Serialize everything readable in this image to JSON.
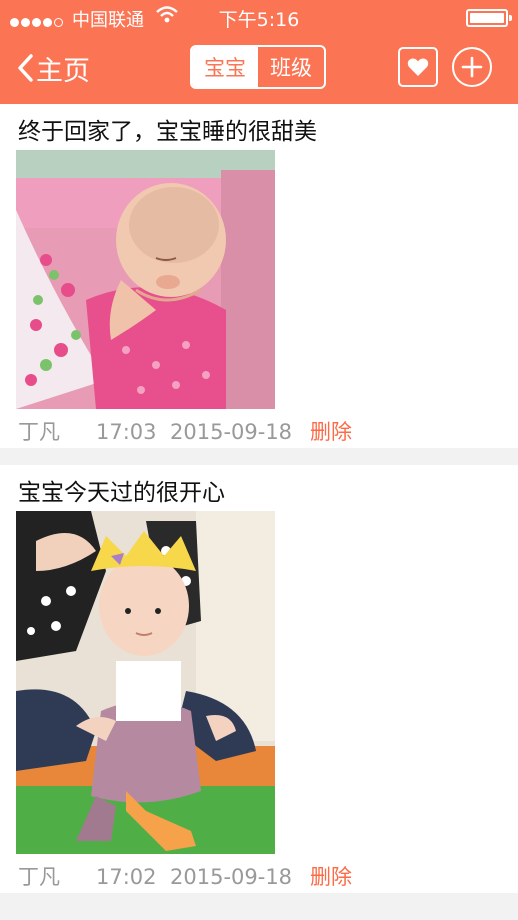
{
  "statusbar": {
    "carrier": "中国联通",
    "time": "下午5:16"
  },
  "nav": {
    "back_label": "主页",
    "segments": [
      "宝宝",
      "班级"
    ],
    "active_segment": "宝宝"
  },
  "posts": [
    {
      "title": "终于回家了，宝宝睡的很甜美",
      "author": "丁凡",
      "time": "17:03",
      "date": "2015-09-18",
      "delete_label": "删除",
      "photo": "sleeping-baby-photo"
    },
    {
      "title": "宝宝今天过的很开心",
      "author": "丁凡",
      "time": "17:02",
      "date": "2015-09-18",
      "delete_label": "删除",
      "photo": "sitting-baby-with-crown-photo"
    }
  ],
  "colors": {
    "accent": "#fb7555",
    "delete": "#fb6b48",
    "meta_text": "#999999",
    "background": "#f2f2f2"
  },
  "icons": [
    "back-chevron-icon",
    "heart-icon",
    "plus-icon",
    "wifi-icon",
    "battery-icon",
    "signal-icon"
  ]
}
